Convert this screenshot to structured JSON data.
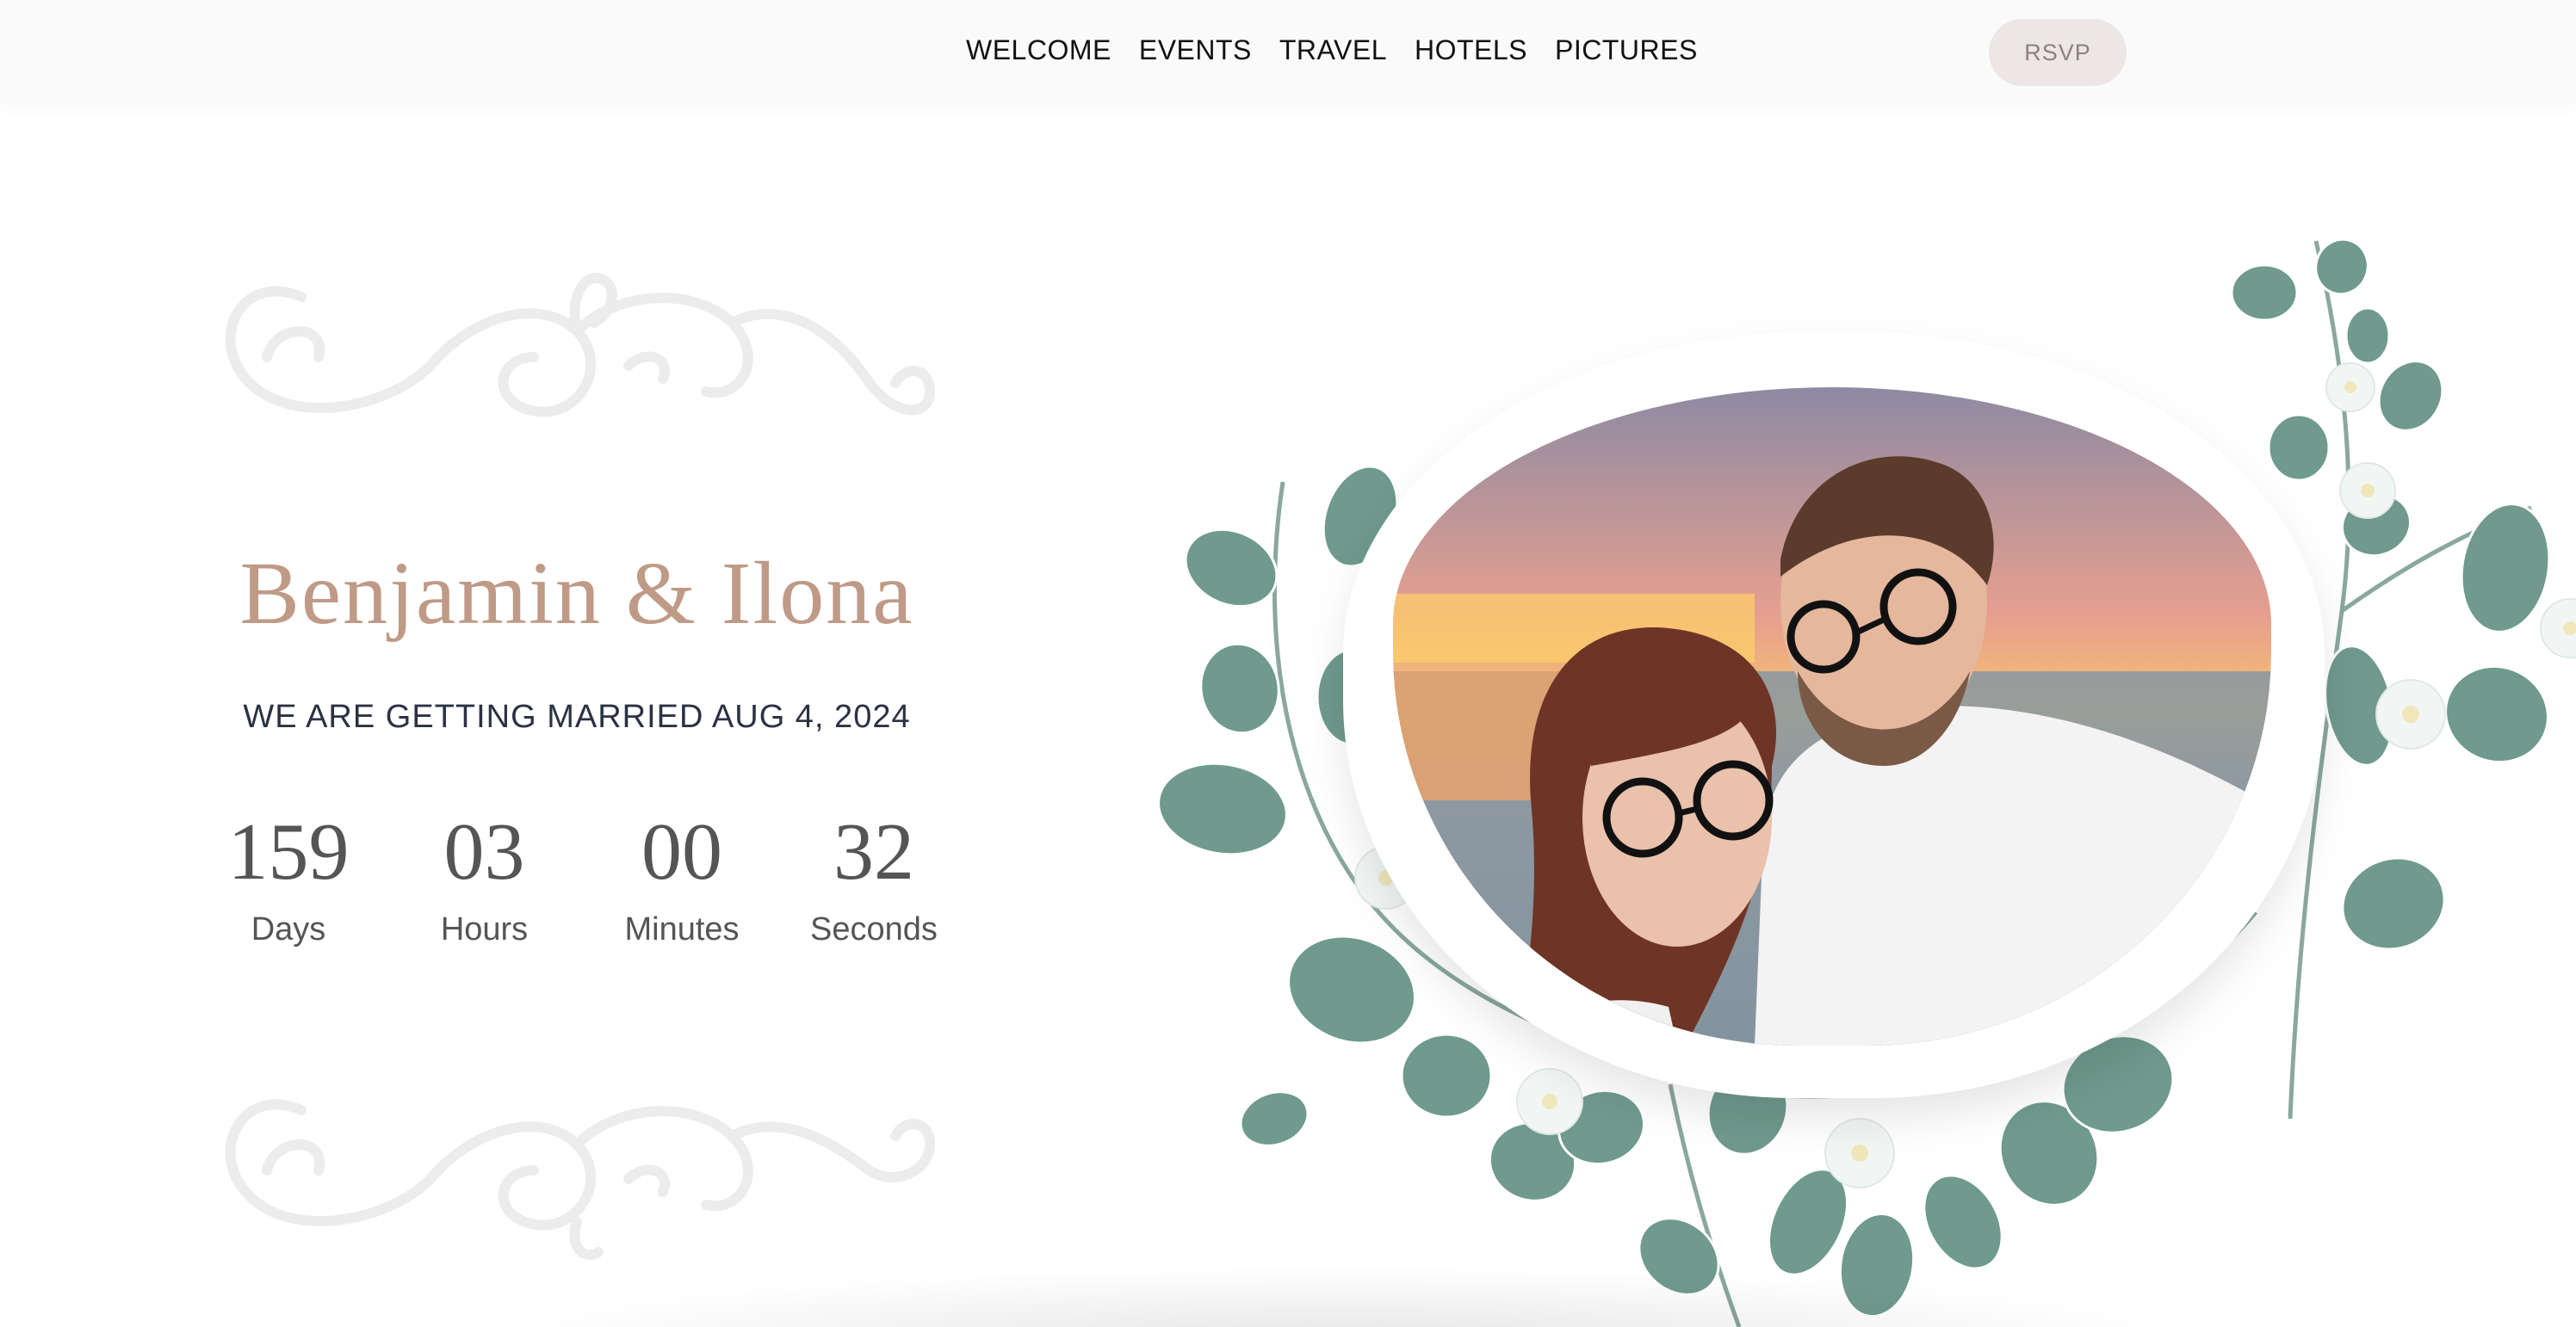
{
  "nav": {
    "links": [
      "WELCOME",
      "EVENTS",
      "TRAVEL",
      "HOTELS",
      "PICTURES"
    ],
    "rsvp_label": "RSVP"
  },
  "hero": {
    "names": "Benjamin & Ilona",
    "tagline": "WE ARE GETTING MARRIED AUG 4, 2024",
    "countdown": [
      {
        "value": "159",
        "label": "Days"
      },
      {
        "value": "03",
        "label": "Hours"
      },
      {
        "value": "00",
        "label": "Minutes"
      },
      {
        "value": "32",
        "label": "Seconds"
      }
    ],
    "photo_icon": "couple-portrait-photo"
  },
  "colors": {
    "names": "#bf9a86",
    "tagline": "#2a3243",
    "rsvp_bg": "#ede6e6",
    "rsvp_text": "#8f7f7f",
    "leaf": "#6f9a8d",
    "flourish": "#ececec"
  }
}
